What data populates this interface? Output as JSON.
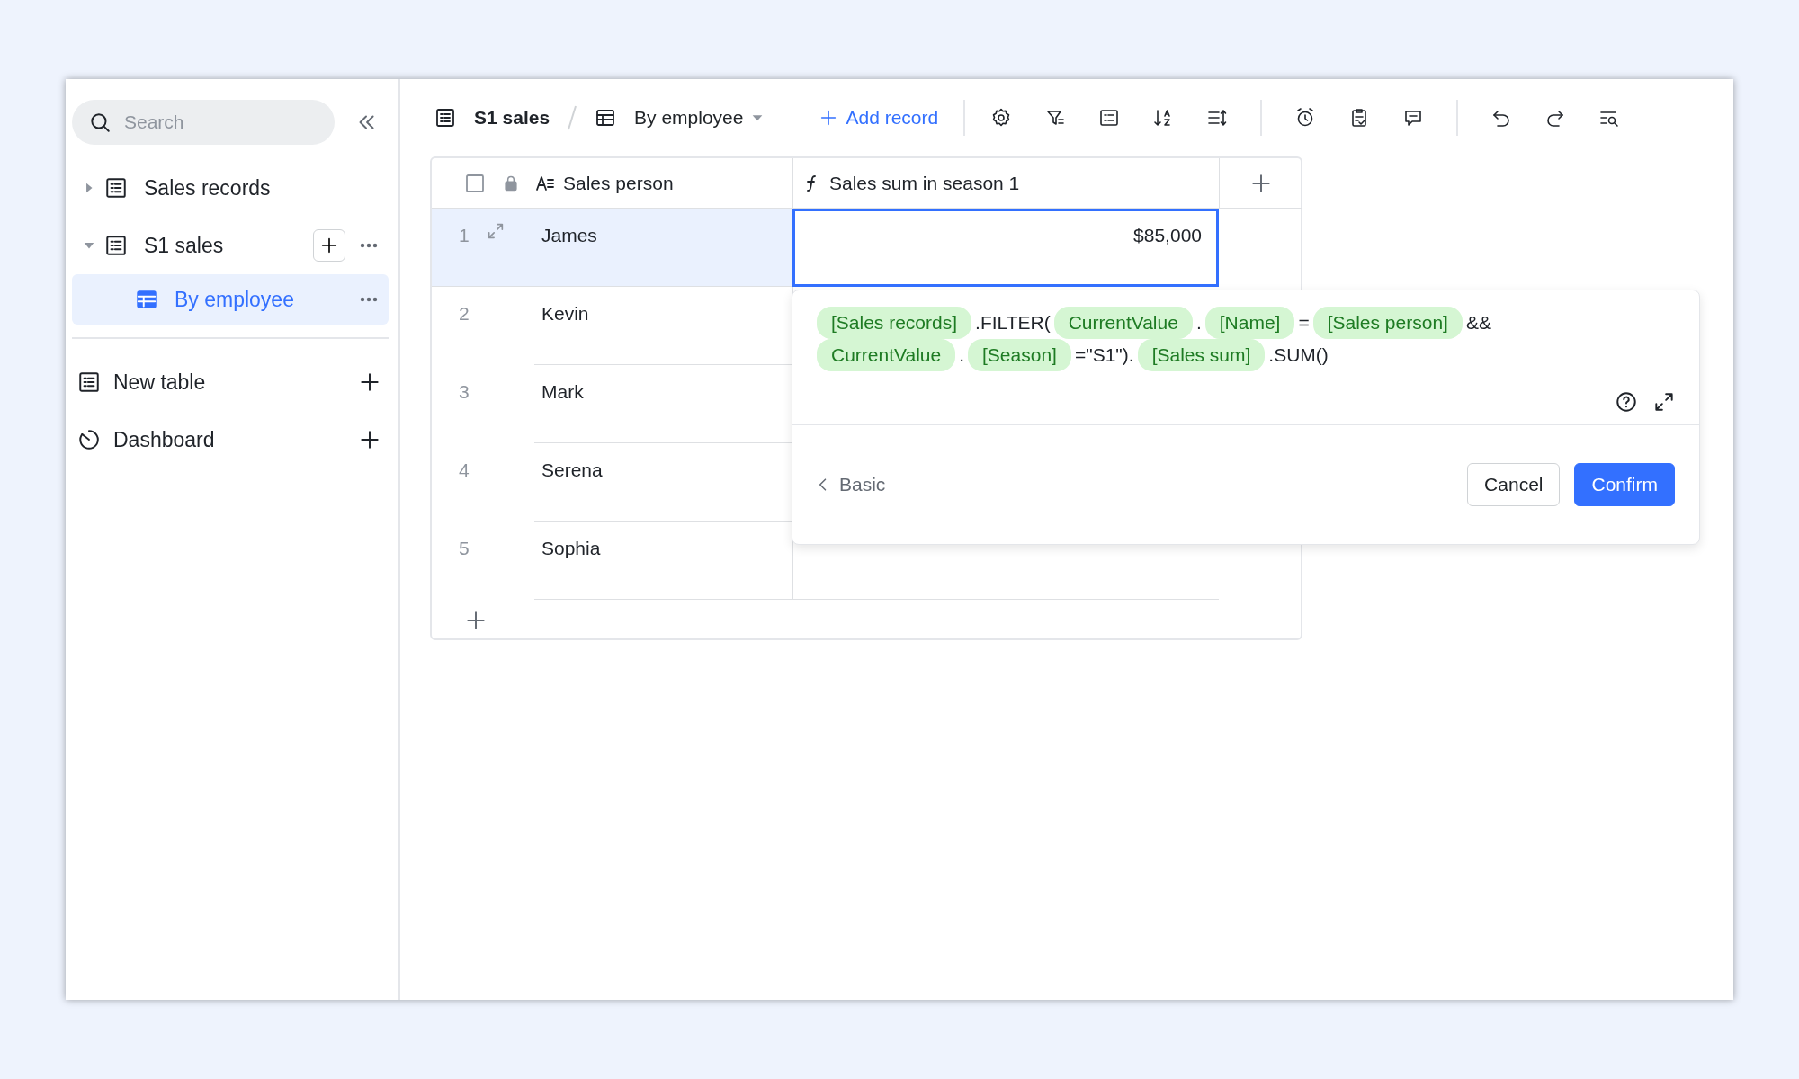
{
  "sidebar": {
    "search": {
      "placeholder": "Search"
    },
    "tree": [
      {
        "label": "Sales records",
        "expanded": false,
        "selected": false,
        "hovered": false
      },
      {
        "label": "S1 sales",
        "expanded": true,
        "selected": false,
        "hovered": true,
        "children": [
          {
            "label": "By employee",
            "selected": true
          }
        ]
      }
    ],
    "sections": [
      {
        "label": "New table",
        "kind": "table"
      },
      {
        "label": "Dashboard",
        "kind": "dashboard"
      }
    ]
  },
  "toolbar": {
    "table": "S1 sales",
    "view": "By employee",
    "add_record": "Add record"
  },
  "table": {
    "select_all": {
      "checked": false
    },
    "columns": [
      {
        "label": "Sales person",
        "kind": "text"
      },
      {
        "label": "Sales sum in season 1",
        "kind": "formula"
      }
    ],
    "rows": [
      {
        "number": "1",
        "name": "James",
        "value": "$85,000",
        "selected": true
      },
      {
        "number": "2",
        "name": "Kevin",
        "selected": false
      },
      {
        "number": "3",
        "name": "Mark",
        "selected": false
      },
      {
        "number": "4",
        "name": "Serena",
        "selected": false
      },
      {
        "number": "5",
        "name": "Sophia",
        "selected": false
      }
    ]
  },
  "formula_editor": {
    "lines": [
      [
        {
          "kind": "field",
          "text": "[Sales records]"
        },
        {
          "kind": "text",
          "text": ".FILTER("
        },
        {
          "kind": "field",
          "text": "CurrentValue"
        },
        {
          "kind": "text",
          "text": "."
        },
        {
          "kind": "field",
          "text": "[Name]"
        },
        {
          "kind": "text",
          "text": "="
        },
        {
          "kind": "field",
          "text": "[Sales person]"
        },
        {
          "kind": "text",
          "text": "&&"
        }
      ],
      [
        {
          "kind": "field",
          "text": "CurrentValue"
        },
        {
          "kind": "text",
          "text": "."
        },
        {
          "kind": "field",
          "text": "[Season]"
        },
        {
          "kind": "text",
          "text": "=\"S1\")."
        },
        {
          "kind": "field",
          "text": "[Sales sum]"
        },
        {
          "kind": "text",
          "text": ".SUM()"
        }
      ]
    ],
    "mode_link": "Basic",
    "buttons": [
      {
        "label": "Cancel",
        "kind": "secondary"
      },
      {
        "label": "Confirm",
        "kind": "primary"
      }
    ]
  }
}
